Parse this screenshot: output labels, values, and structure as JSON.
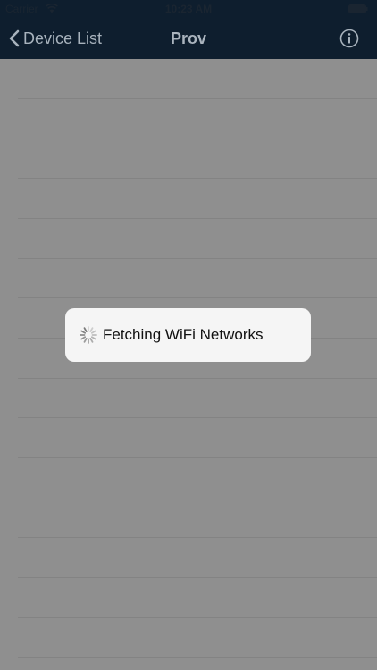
{
  "status_bar": {
    "carrier": "Carrier",
    "time": "10:23 AM",
    "wifi_icon": "wifi-icon",
    "battery_icon": "battery-icon"
  },
  "nav_bar": {
    "back_label": "Device List",
    "back_icon": "chevron-left-icon",
    "title": "Prov",
    "info_icon": "info-icon"
  },
  "list": {
    "row_count": 15
  },
  "hud": {
    "icon": "spinner-icon",
    "message": "Fetching WiFi Networks"
  },
  "colors": {
    "nav_background": "#0e1e2e",
    "dim_background": "#8f8f8f",
    "hud_background": "#f5f5f5",
    "nav_text": "#aab4be"
  }
}
